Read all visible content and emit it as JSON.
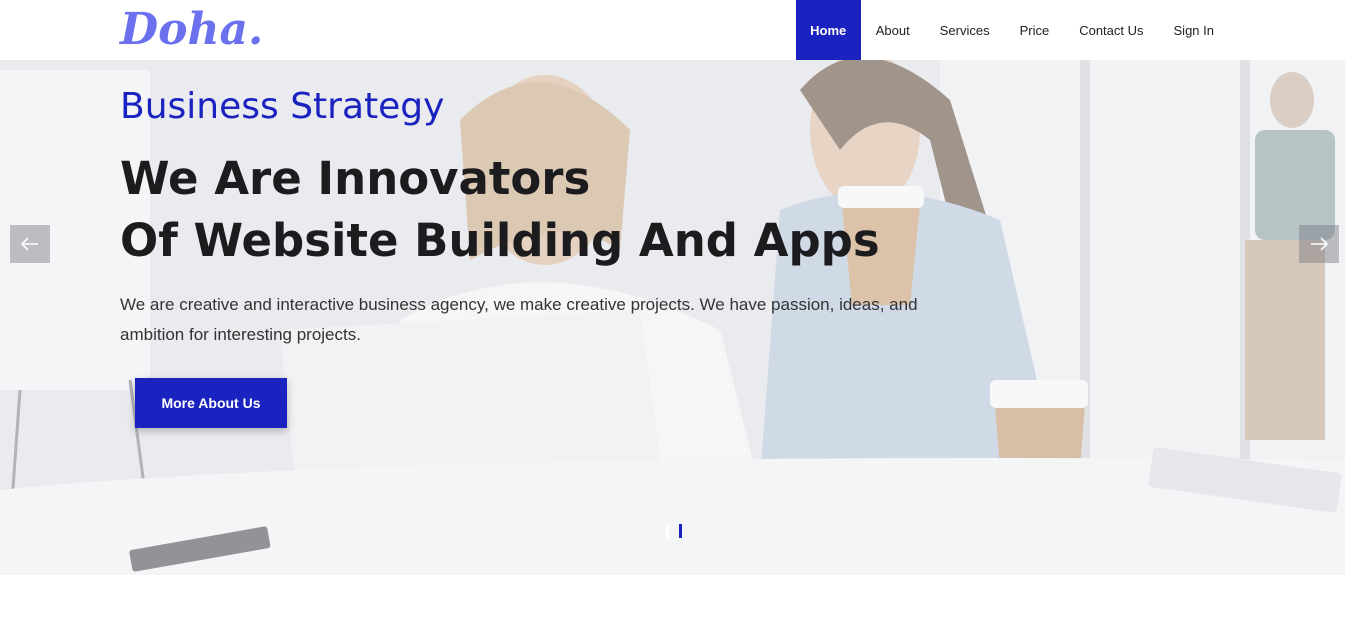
{
  "header": {
    "logo": "Doha.",
    "nav": [
      {
        "label": "Home",
        "active": true
      },
      {
        "label": "About"
      },
      {
        "label": "Services"
      },
      {
        "label": "Price"
      },
      {
        "label": "Contact Us"
      },
      {
        "label": "Sign In"
      }
    ]
  },
  "hero": {
    "eyebrow": "Business Strategy",
    "title_line1": "We Are Innovators",
    "title_line2": "Of Website Building And Apps",
    "text": "We are creative and interactive business agency, we make creative projects. We have passion, ideas, and ambition for interesting projects.",
    "button": "More About Us",
    "prev_icon": "arrow-left-icon",
    "next_icon": "arrow-right-icon",
    "slides": 2,
    "active_slide": 2
  },
  "colors": {
    "brand": "#1a22bf",
    "logo": "#6a70ee",
    "title": "#1c1c1f"
  }
}
